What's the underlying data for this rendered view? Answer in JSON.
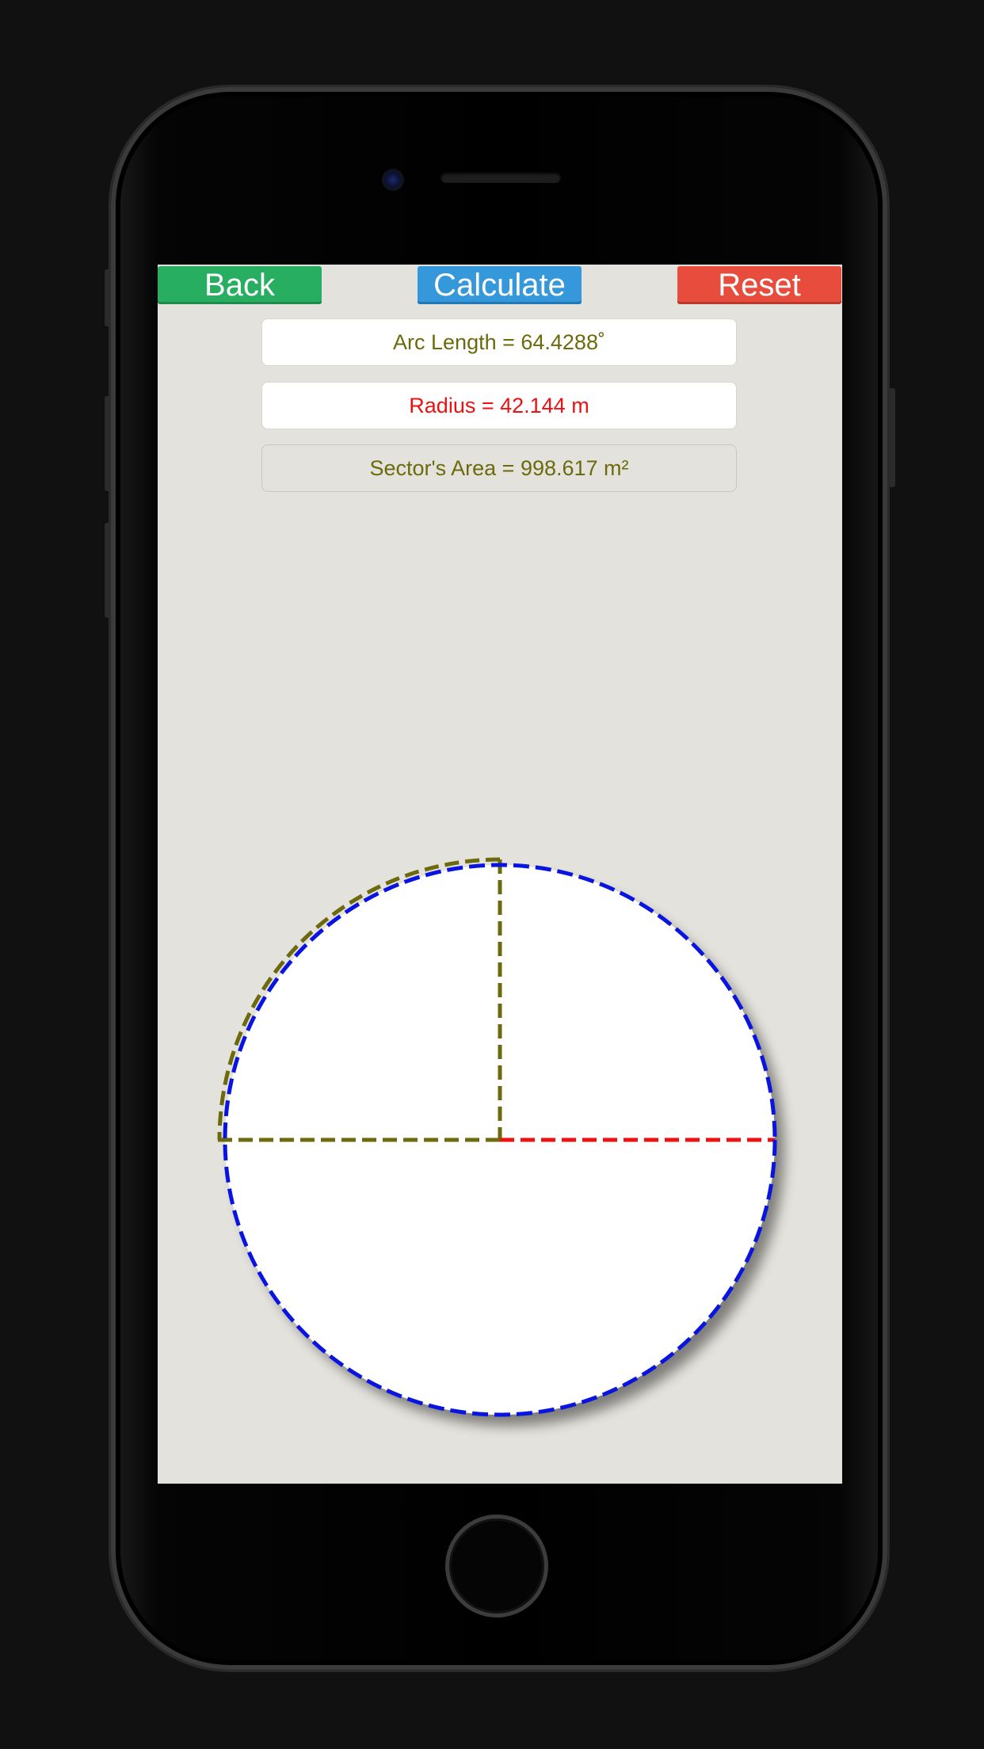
{
  "toolbar": {
    "back_label": "Back",
    "calculate_label": "Calculate",
    "reset_label": "Reset"
  },
  "fields": {
    "arc_length": "Arc Length = 64.4288˚",
    "radius": "Radius = 42.144 m",
    "sector_area": "Sector's Area = 998.617 m²"
  },
  "colors": {
    "back": "#27ae60",
    "calculate": "#3498db",
    "reset": "#e74c3c",
    "circle_outline": "#0a14e0",
    "radius_line": "#ee1111",
    "sector_lines": "#6c6a0d"
  }
}
